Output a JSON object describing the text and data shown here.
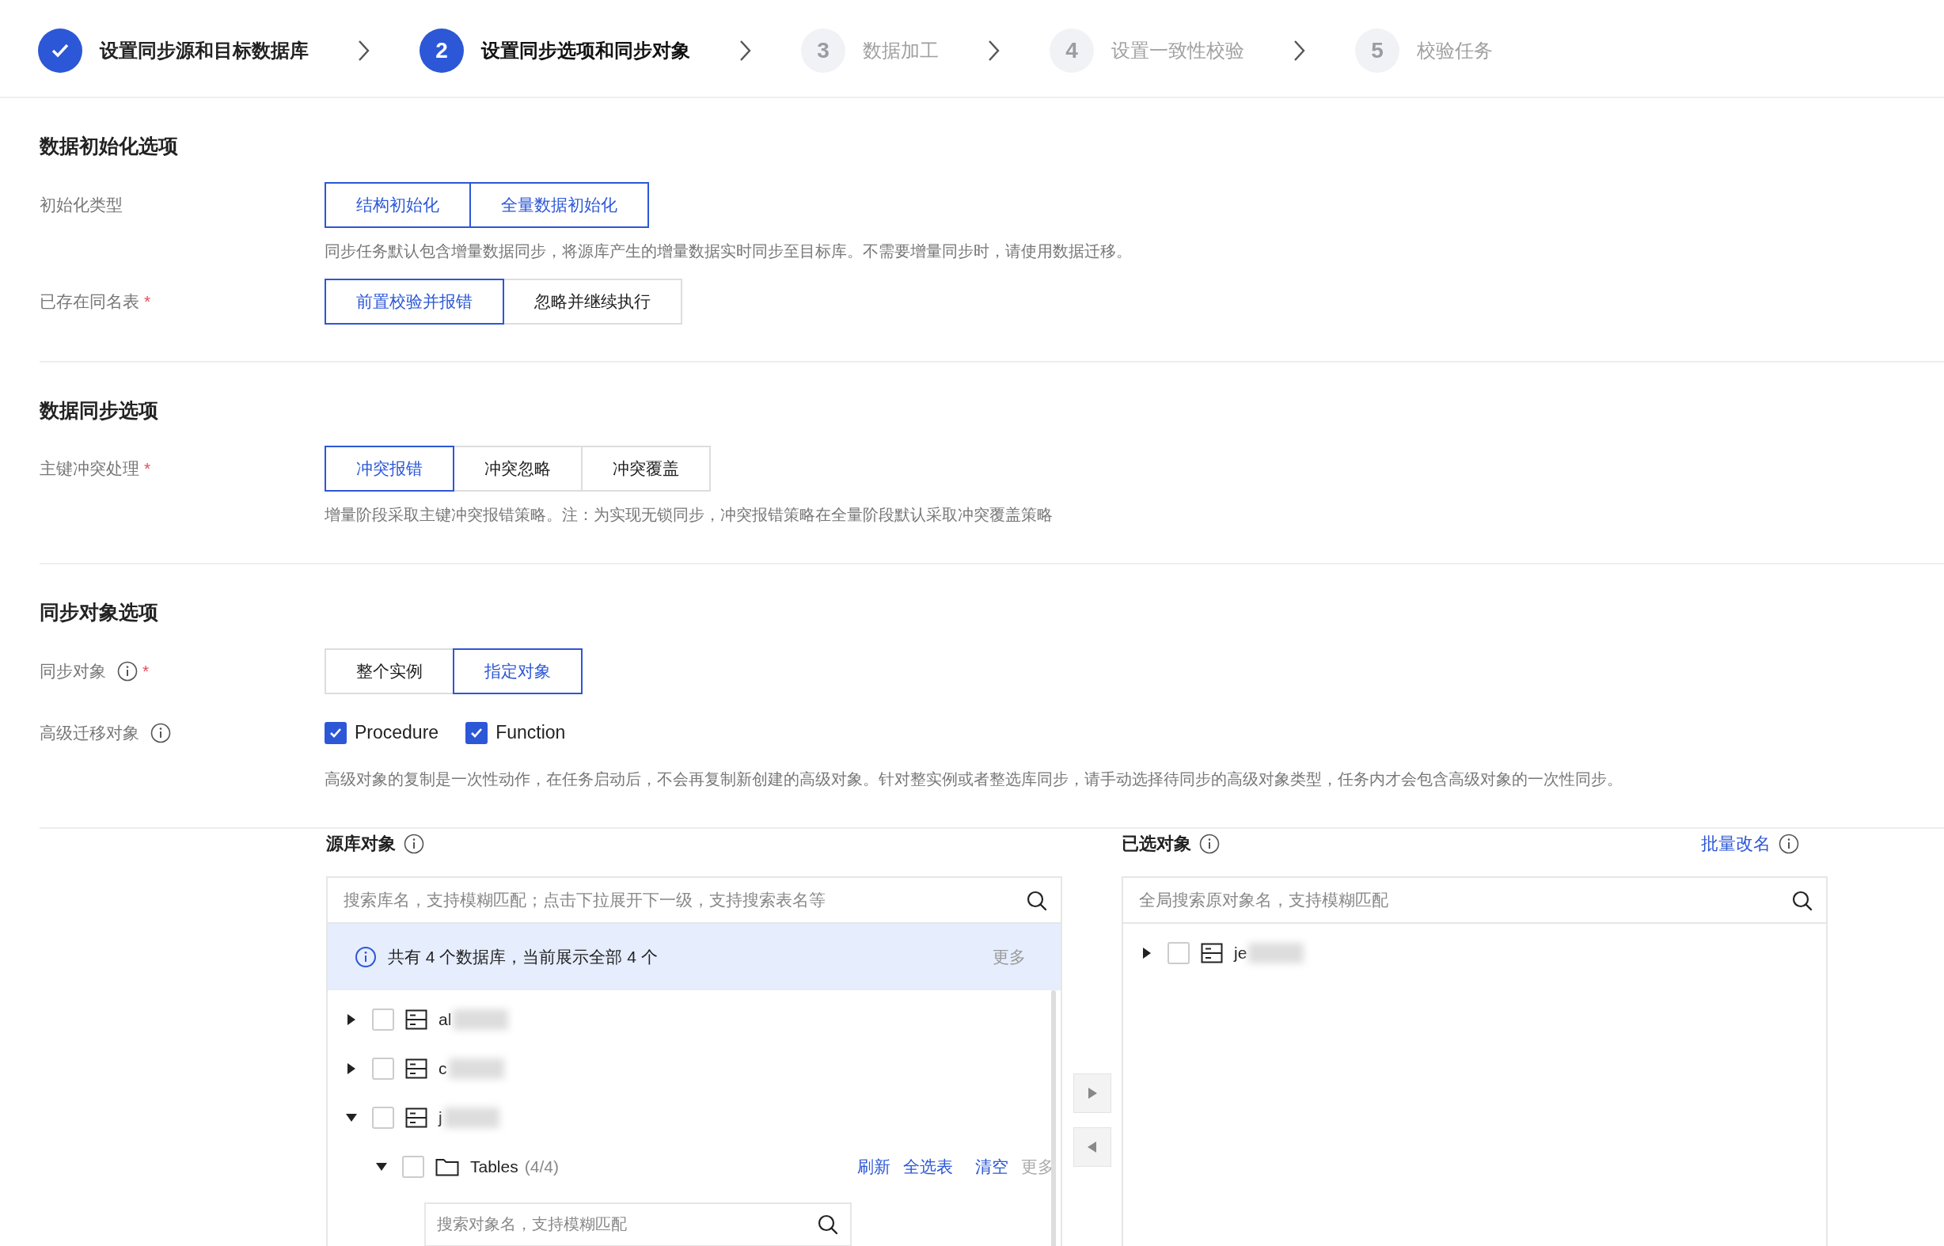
{
  "steps": [
    {
      "label": "设置同步源和目标数据库",
      "done": true,
      "selected": false
    },
    {
      "number": "2",
      "label": "设置同步选项和同步对象",
      "done": false,
      "selected": true
    },
    {
      "number": "3",
      "label": "数据加工",
      "done": false,
      "selected": false
    },
    {
      "number": "4",
      "label": "设置一致性校验",
      "done": false,
      "selected": false
    },
    {
      "number": "5",
      "label": "校验任务",
      "done": false,
      "selected": false
    }
  ],
  "sections": [
    {
      "title": "数据初始化选项",
      "fields": [
        {
          "label": "初始化类型",
          "kind": "segmented",
          "options": [
            {
              "label": "结构初始化",
              "selected": true
            },
            {
              "label": "全量数据初始化",
              "selected": true
            }
          ],
          "hint": "同步任务默认包含增量数据同步，将源库产生的增量数据实时同步至目标库。不需要增量同步时，请使用数据迁移。"
        },
        {
          "label": "已存在同名表",
          "required_mark": "*",
          "kind": "segmented",
          "options": [
            {
              "label": "前置校验并报错",
              "selected": true
            },
            {
              "label": "忽略并继续执行",
              "selected": false
            }
          ]
        }
      ]
    },
    {
      "title": "数据同步选项",
      "fields": [
        {
          "label": "主键冲突处理",
          "required_mark": "*",
          "kind": "segmented",
          "options": [
            {
              "label": "冲突报错",
              "selected": true
            },
            {
              "label": "冲突忽略",
              "selected": false
            },
            {
              "label": "冲突覆盖",
              "selected": false
            }
          ],
          "hint": "增量阶段采取主键冲突报错策略。注：为实现无锁同步，冲突报错策略在全量阶段默认采取冲突覆盖策略"
        }
      ]
    },
    {
      "title": "同步对象选项",
      "fields": [
        {
          "label": "同步对象",
          "info": true,
          "required_mark": "*",
          "kind": "segmented",
          "options": [
            {
              "label": "整个实例",
              "selected": false
            },
            {
              "label": "指定对象",
              "selected": true
            }
          ]
        },
        {
          "label": "高级迁移对象",
          "info": true,
          "kind": "checkboxes",
          "options": [
            {
              "label": "Procedure",
              "checked": true
            },
            {
              "label": "Function",
              "checked": true
            }
          ],
          "hint": "高级对象的复制是一次性动作，在任务启动后，不会再复制新创建的高级对象。针对整实例或者整选库同步，请手动选择待同步的高级对象类型，任务内才会包含高级对象的一次性同步。"
        }
      ]
    }
  ],
  "source": {
    "title": "源库对象",
    "search": {
      "placeholder": "搜索库名，支持模糊匹配；点击下拉展开下一级，支持搜索表名等"
    },
    "banner": {
      "text": "共有 4 个数据库，当前展示全部 4 个",
      "more": "更多"
    },
    "tree": [
      {
        "kind": "database",
        "name": "al",
        "expanded": false,
        "checked": false
      },
      {
        "kind": "database",
        "name": "c",
        "expanded": false,
        "checked": false
      },
      {
        "kind": "database",
        "name": "j",
        "expanded": true,
        "checked": false,
        "children": [
          {
            "kind": "folder",
            "name": "Tables",
            "count": "(4/4)",
            "expanded": true,
            "checked": false,
            "actions": [
              "刷新",
              "全选表",
              "清空"
            ],
            "more": "更多",
            "search": {
              "placeholder": "搜索对象名，支持模糊匹配"
            }
          }
        ]
      }
    ]
  },
  "target": {
    "title": "已选对象",
    "rename": "批量改名",
    "search": {
      "placeholder": "全局搜索原对象名，支持模糊匹配"
    },
    "tree": [
      {
        "kind": "database",
        "name": "je",
        "expanded": false,
        "checked": false
      }
    ]
  }
}
